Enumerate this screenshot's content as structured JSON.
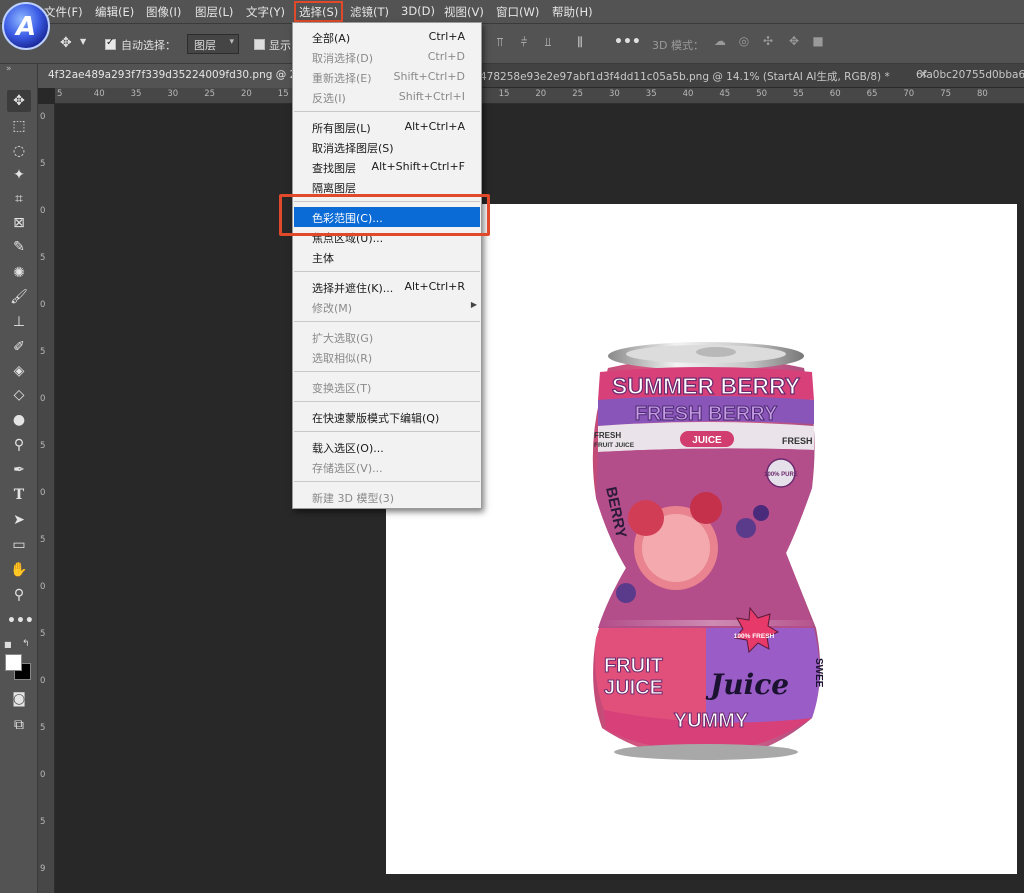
{
  "menubar": {
    "items": [
      "文件(F)",
      "编辑(E)",
      "图像(I)",
      "图层(L)",
      "文字(Y)",
      "选择(S)",
      "滤镜(T)",
      "3D(D)",
      "视图(V)",
      "窗口(W)",
      "帮助(H)"
    ]
  },
  "optionsbar": {
    "auto_select_label": "自动选择：",
    "auto_select_checked": true,
    "target_dropdown": "图层",
    "show_label": "显示",
    "mode_3d_label": "3D 模式："
  },
  "tabs": [
    {
      "label": "4f32ae489a293f7f339d35224009fd30.png @ 2",
      "active": true
    },
    {
      "label": "478258e93e2e97abf1d3f4dd11c05a5b.png @ 14.1% (StartAI AI生成, RGB/8) *",
      "active": false
    },
    {
      "label": "6fa0bc20755d0bba6",
      "active": false
    }
  ],
  "ruler_top": [
    "5",
    "40",
    "35",
    "30",
    "25",
    "20",
    "15",
    "10",
    "5",
    "0",
    "5",
    "10",
    "15",
    "20",
    "25",
    "30",
    "35",
    "40",
    "45",
    "50",
    "55",
    "60",
    "65",
    "70",
    "75",
    "80"
  ],
  "ruler_left": [
    "0",
    "5",
    "0",
    "5",
    "0",
    "5",
    "0",
    "5",
    "0",
    "5",
    "0",
    "5",
    "0",
    "5",
    "0",
    "5",
    "9"
  ],
  "select_menu": {
    "items": [
      {
        "label": "全部(A)",
        "shortcut": "Ctrl+A",
        "enabled": true
      },
      {
        "label": "取消选择(D)",
        "shortcut": "Ctrl+D",
        "enabled": false
      },
      {
        "label": "重新选择(E)",
        "shortcut": "Shift+Ctrl+D",
        "enabled": false
      },
      {
        "label": "反选(I)",
        "shortcut": "Shift+Ctrl+I",
        "enabled": false
      },
      {
        "label": "所有图层(L)",
        "shortcut": "Alt+Ctrl+A",
        "enabled": true
      },
      {
        "label": "取消选择图层(S)",
        "shortcut": "",
        "enabled": true
      },
      {
        "label": "查找图层",
        "shortcut": "Alt+Shift+Ctrl+F",
        "enabled": true
      },
      {
        "label": "隔离图层",
        "shortcut": "",
        "enabled": true
      },
      {
        "label": "色彩范围(C)...",
        "shortcut": "",
        "enabled": true,
        "highlighted": true
      },
      {
        "label": "焦点区域(U)...",
        "shortcut": "",
        "enabled": true
      },
      {
        "label": "主体",
        "shortcut": "",
        "enabled": true
      },
      {
        "label": "选择并遮住(K)...",
        "shortcut": "Alt+Ctrl+R",
        "enabled": true
      },
      {
        "label": "修改(M)",
        "shortcut": "",
        "enabled": false,
        "submenu": true
      },
      {
        "label": "扩大选取(G)",
        "shortcut": "",
        "enabled": false
      },
      {
        "label": "选取相似(R)",
        "shortcut": "",
        "enabled": false
      },
      {
        "label": "变换选区(T)",
        "shortcut": "",
        "enabled": false
      },
      {
        "label": "在快速蒙版模式下编辑(Q)",
        "shortcut": "",
        "enabled": true
      },
      {
        "label": "载入选区(O)...",
        "shortcut": "",
        "enabled": true
      },
      {
        "label": "存储选区(V)...",
        "shortcut": "",
        "enabled": false
      },
      {
        "label": "新建 3D 模型(3)",
        "shortcut": "",
        "enabled": false
      }
    ]
  },
  "can_artwork": {
    "line1": "SUMMER BERRY",
    "line2": "FRESH BERRY",
    "badge": "JUICE",
    "small_left": "FRESH",
    "small_left2": "FRUIT JUICE",
    "small_right": "FRESH",
    "side": "BERRY",
    "pure": "100% PURE",
    "fresh_star": "100% FRESH",
    "fruit": "FRUIT",
    "juice": "JUICE",
    "script": "Juice",
    "yummy": "YUMMY",
    "vertical": "SWEE"
  },
  "colors": {
    "accent": "#e04a2a",
    "menu_highlight": "#0a6ad6",
    "can_pink": "#e0557a",
    "can_purple": "#8a55b8"
  }
}
